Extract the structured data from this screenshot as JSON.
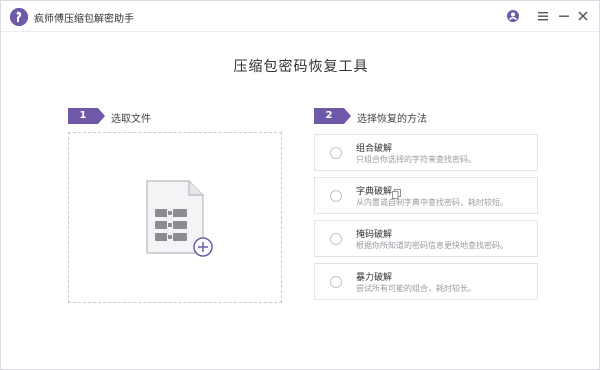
{
  "app": {
    "title": "疯师傅压缩包解密助手",
    "heading": "压缩包密码恢复工具"
  },
  "steps": [
    {
      "number": "1",
      "label": "选取文件"
    },
    {
      "number": "2",
      "label": "选择恢复的方法"
    }
  ],
  "methods": [
    {
      "title": "组合破解",
      "description": "只组合你选择的字符来查找密码。"
    },
    {
      "title": "字典破解",
      "description": "从内置或自制字典中查找密码，耗时较短。"
    },
    {
      "title": "掩码破解",
      "description": "根据你所知道的密码信息更快地查找密码。"
    },
    {
      "title": "暴力破解",
      "description": "尝试所有可能的组合，耗时较长。"
    }
  ],
  "colors": {
    "accent": "#6e5aa8",
    "border": "#e3e3e8"
  },
  "icons": {
    "logo": "app-logo-icon",
    "user": "user-icon",
    "menu": "menu-icon",
    "minimize": "minimize-icon",
    "close": "close-icon",
    "file": "archive-file-icon",
    "add": "add-circle-icon",
    "copy": "copy-icon"
  }
}
